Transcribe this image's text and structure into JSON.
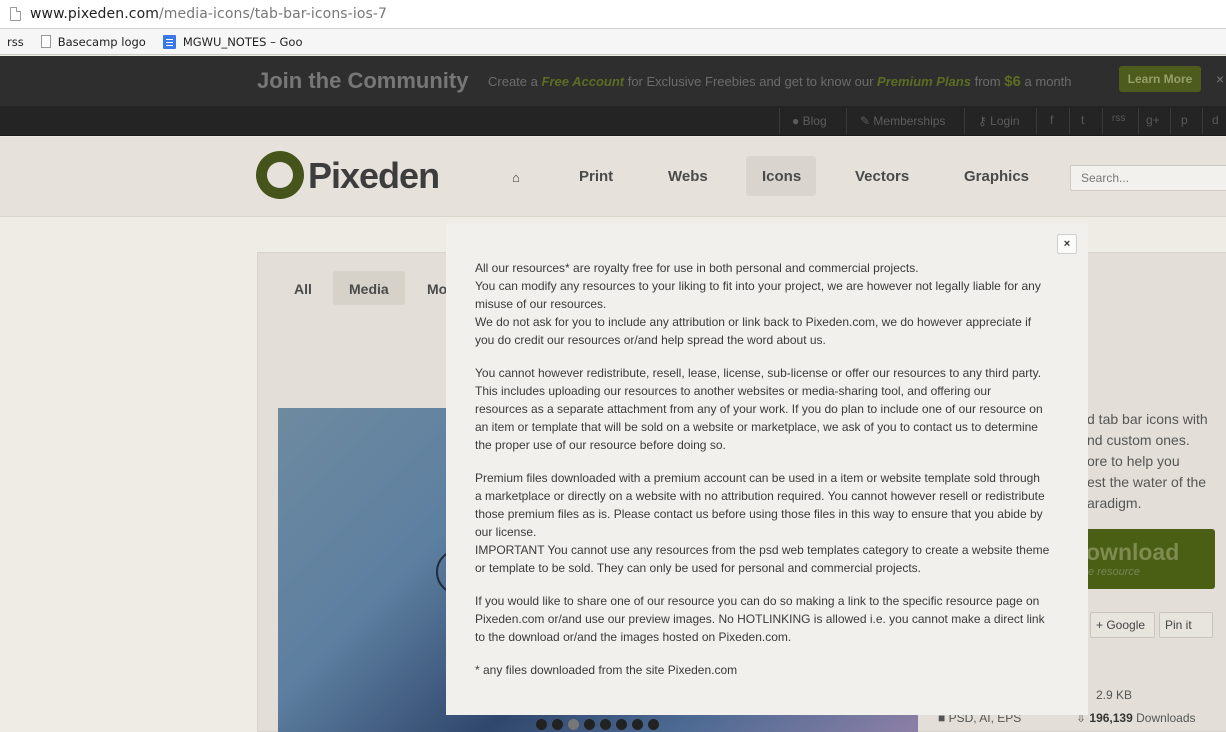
{
  "browser": {
    "url_host": "www.pixeden.com",
    "url_path": "/media-icons/tab-bar-icons-ios-7",
    "bookmarks": [
      "rss",
      "Basecamp logo",
      "MGWU_NOTES – Goo"
    ]
  },
  "promo": {
    "title": "Join the Community",
    "create_a": "Create a",
    "free_account": "Free Account",
    "for_exclusive": "for Exclusive Freebies and get to know our",
    "premium_plans": "Premium Plans",
    "from": "from",
    "price": "$6",
    "a_month": "a month",
    "learn_more": "Learn More",
    "close": "×"
  },
  "topnav": {
    "blog": "Blog",
    "memberships": "Memberships",
    "login": "Login"
  },
  "social_icons": [
    "f",
    "t",
    "rss",
    "g+",
    "p",
    "d"
  ],
  "site": {
    "logo": "Pixeden",
    "nav": [
      "Print",
      "Webs",
      "Icons",
      "Vectors",
      "Graphics"
    ],
    "active_nav": "Icons",
    "search_placeholder": "Search..."
  },
  "tabs": [
    "All",
    "Media",
    "Mo"
  ],
  "side": {
    "text": "d tab bar icons with\nnd custom ones.\nore to help you\nest the water of the\naradigm.",
    "download": "ownload",
    "download_sub": "e resource",
    "share": [
      "+ Google",
      "Pin it"
    ],
    "size": "2.9 KB",
    "formats": "PSD, AI, EPS",
    "downloads_count": "196,139",
    "downloads_label": "Downloads"
  },
  "modal": {
    "close": "×",
    "p1": [
      "All our resources* are royalty free for use in both personal and commercial projects.",
      "You can modify any resources to your liking to fit into your project, we are however not legally liable for any",
      "misuse of our resources.",
      "We do not ask for you to include any attribution or link back to Pixeden.com, we do however appreciate if",
      "you do credit our resources or/and help spread the word about us."
    ],
    "p2": [
      "You cannot however redistribute, resell, lease, license, sub-license or offer our resources to any third party.",
      "This includes uploading our resources to another websites or media-sharing tool, and offering our",
      "resources as a separate attachment from any of your work. If you do plan to include one of our resource on",
      "an item or template that will be sold on a website or marketplace, we ask of you to contact us to determine",
      "the proper use of our resource before doing so."
    ],
    "p3": [
      "Premium files downloaded with a premium account can be used in a item or website template sold through",
      "a marketplace or directly on a website with no attribution required. You cannot however resell or redistribute",
      "those premium files as is. Please contact us before using those files in this way to ensure that you abide by",
      "our license.",
      "IMPORTANT You cannot use any resources from the psd web templates category to create a website theme",
      "or template to be sold. They can only be used for personal and commercial projects."
    ],
    "p4": [
      "If you would like to share one of our resource you can do so making a link to the specific resource page on",
      "Pixeden.com or/and use our preview images. No HOTLINKING is allowed i.e. you cannot make a direct link",
      "to the download or/and the images hosted on Pixeden.com."
    ],
    "footnote": "* any files downloaded from the site Pixeden.com"
  }
}
